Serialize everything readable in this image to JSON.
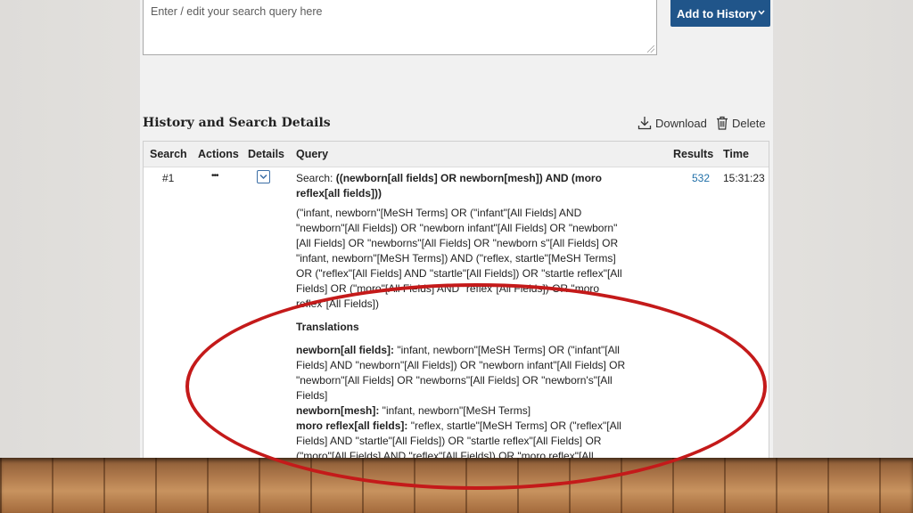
{
  "search_box": {
    "placeholder": "Enter / edit your search query here"
  },
  "add_history_button": {
    "label": "Add to History"
  },
  "history": {
    "title": "History and Search Details",
    "download_label": "Download",
    "delete_label": "Delete",
    "columns": {
      "search": "Search",
      "actions": "Actions",
      "details": "Details",
      "query": "Query",
      "results": "Results",
      "time": "Time"
    },
    "row": {
      "number": "#1",
      "actions": "•••",
      "search_prefix": "Search: ",
      "search_query": "((newborn[all fields] OR newborn[mesh]) AND (moro reflex[all fields]))",
      "details_text": "(\"infant, newborn\"[MeSH Terms] OR (\"infant\"[All Fields] AND \"newborn\"[All Fields]) OR \"newborn infant\"[All Fields] OR \"newborn\"[All Fields] OR \"newborns\"[All Fields] OR \"newborn s\"[All Fields] OR \"infant, newborn\"[MeSH Terms]) AND (\"reflex, startle\"[MeSH Terms] OR (\"reflex\"[All Fields] AND \"startle\"[All Fields]) OR \"startle reflex\"[All Fields] OR (\"moro\"[All Fields] AND \"reflex\"[All Fields]) OR \"moro reflex\"[All Fields])",
      "results": "532",
      "time": "15:31:23",
      "translations_heading": "Translations",
      "translations": [
        {
          "term": "newborn[all fields]:",
          "value": " \"infant, newborn\"[MeSH Terms] OR (\"infant\"[All Fields] AND \"newborn\"[All Fields]) OR \"newborn infant\"[All Fields] OR \"newborn\"[All Fields] OR \"newborns\"[All Fields] OR \"newborn's\"[All Fields]"
        },
        {
          "term": "newborn[mesh]:",
          "value": " \"infant, newborn\"[MeSH Terms]"
        },
        {
          "term": "moro reflex[all fields]:",
          "value": " \"reflex, startle\"[MeSH Terms] OR (\"reflex\"[All Fields] AND \"startle\"[All Fields]) OR \"startle reflex\"[All Fields] OR (\"moro\"[All Fields] AND \"reflex\"[All Fields]) OR \"moro reflex\"[All Fields]"
        }
      ]
    }
  },
  "colors": {
    "accent": "#20558a",
    "link": "#1f6fa8",
    "annotation": "#c41a1a"
  },
  "icons": [
    "download-icon",
    "trash-icon",
    "chevron-down-icon"
  ]
}
